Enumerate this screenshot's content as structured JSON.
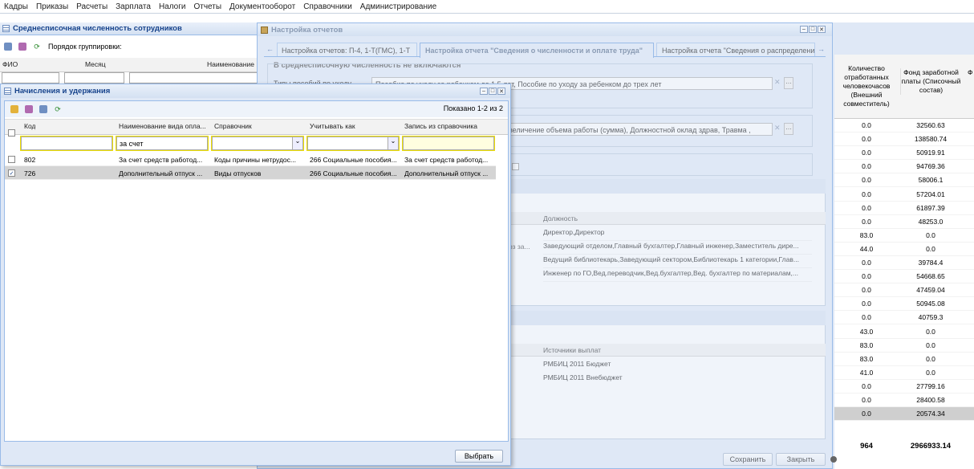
{
  "menu": [
    "Кадры",
    "Приказы",
    "Расчеты",
    "Зарплата",
    "Налоги",
    "Отчеты",
    "Документооборот",
    "Справочники",
    "Администрирование"
  ],
  "bg_panel": {
    "title": "Среднесписочная численность сотрудников",
    "group_label": "Порядок группировки:",
    "col_fio": "ФИО",
    "col_month": "Месяц",
    "col_name": "Наименование"
  },
  "settings": {
    "title": "Настройка отчетов",
    "tabs": [
      "Настройка отчетов: П-4, 1-Т(ГМС), 1-Т",
      "Настройка отчета \"Сведения о численности и оплате труда\"",
      "Настройка отчета \"Сведения о распределении"
    ],
    "section1": "В среднесписочную численность не включаются",
    "types_label": "Типы пособий по уходу",
    "types_value": "Пособие по уходу за ребенком до 1,5 лет, Пособие по уходу за ребенком до трех лет",
    "accruals_value": "величение объема работы (сумма), Должностной оклад здрав, Травма ,",
    "pos_header": "Должность",
    "positions": [
      "Директор,Директор",
      "Заведующий отделом,Главный бухгалтер,Главный инженер,Заместитель дире...",
      "Ведущий библиотекарь,Заведующий сектором,Библиотекарь 1 категории,Глав...",
      "Инженер по ГО,Вед.переводчик,Вед.бухгалтер,Вед. бухгалтер по материалам,..."
    ],
    "pos_side_fragment": "оз за...",
    "src_header": "Источники выплат",
    "sources": [
      "РМБИЦ 2011 Бюджет",
      "РМБИЦ 2011 Внебюджет"
    ],
    "save": "Сохранить",
    "close": "Закрыть"
  },
  "right_table": {
    "col1": "Количество отработанных человекочасов (Внешний совместитель)",
    "col2": "Фонд заработной платы (Списочный состав)",
    "col3": "Ф",
    "rows": [
      [
        "0.0",
        "32560.63"
      ],
      [
        "0.0",
        "138580.74"
      ],
      [
        "0.0",
        "50919.91"
      ],
      [
        "0.0",
        "94769.36"
      ],
      [
        "0.0",
        "58006.1"
      ],
      [
        "0.0",
        "57204.01"
      ],
      [
        "0.0",
        "61897.39"
      ],
      [
        "0.0",
        "48253.0"
      ],
      [
        "83.0",
        "0.0"
      ],
      [
        "44.0",
        "0.0"
      ],
      [
        "0.0",
        "39784.4"
      ],
      [
        "0.0",
        "54668.65"
      ],
      [
        "0.0",
        "47459.04"
      ],
      [
        "0.0",
        "50945.08"
      ],
      [
        "0.0",
        "40759.3"
      ],
      [
        "43.0",
        "0.0"
      ],
      [
        "83.0",
        "0.0"
      ],
      [
        "83.0",
        "0.0"
      ],
      [
        "41.0",
        "0.0"
      ],
      [
        "0.0",
        "27799.16"
      ],
      [
        "0.0",
        "28400.58"
      ],
      [
        "0.0",
        "20574.34"
      ]
    ],
    "totals": [
      "964",
      "2966933.14"
    ]
  },
  "dialog": {
    "title": "Начисления и удержания",
    "shown": "Показано 1-2 из 2",
    "columns": [
      "Код",
      "Наименование вида опла...",
      "Справочник",
      "Учитывать как",
      "Запись из справочника"
    ],
    "filter_name": "за счет",
    "rows": [
      {
        "checked": false,
        "code": "802",
        "name": "За счет средств работод...",
        "ref": "Коды причины нетрудос...",
        "as": "266 Социальные пособия...",
        "entry": "За счет средств работод..."
      },
      {
        "checked": true,
        "code": "726",
        "name": "Дополнительный отпуск ...",
        "ref": "Виды отпусков",
        "as": "266 Социальные пособия...",
        "entry": "Дополнительный отпуск ..."
      }
    ],
    "select": "Выбрать"
  }
}
